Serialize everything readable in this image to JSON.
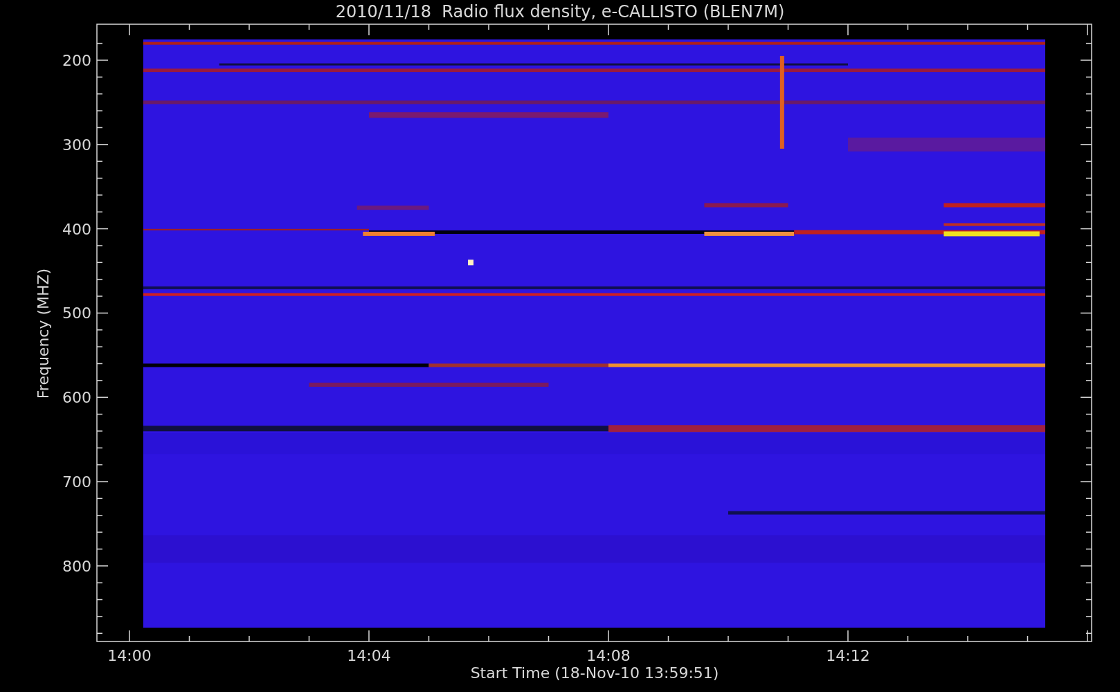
{
  "title": "2010/11/18  Radio flux density, e-CALLISTO (BLEN7M)",
  "y_axis": {
    "label": "Frequency (MHZ)",
    "ticks": [
      "200",
      "300",
      "400",
      "500",
      "600",
      "700",
      "800"
    ]
  },
  "x_axis": {
    "label": "Start Time (18-Nov-10 13:59:51)",
    "ticks": [
      "14:00",
      "14:04",
      "14:08",
      "14:12"
    ]
  }
}
